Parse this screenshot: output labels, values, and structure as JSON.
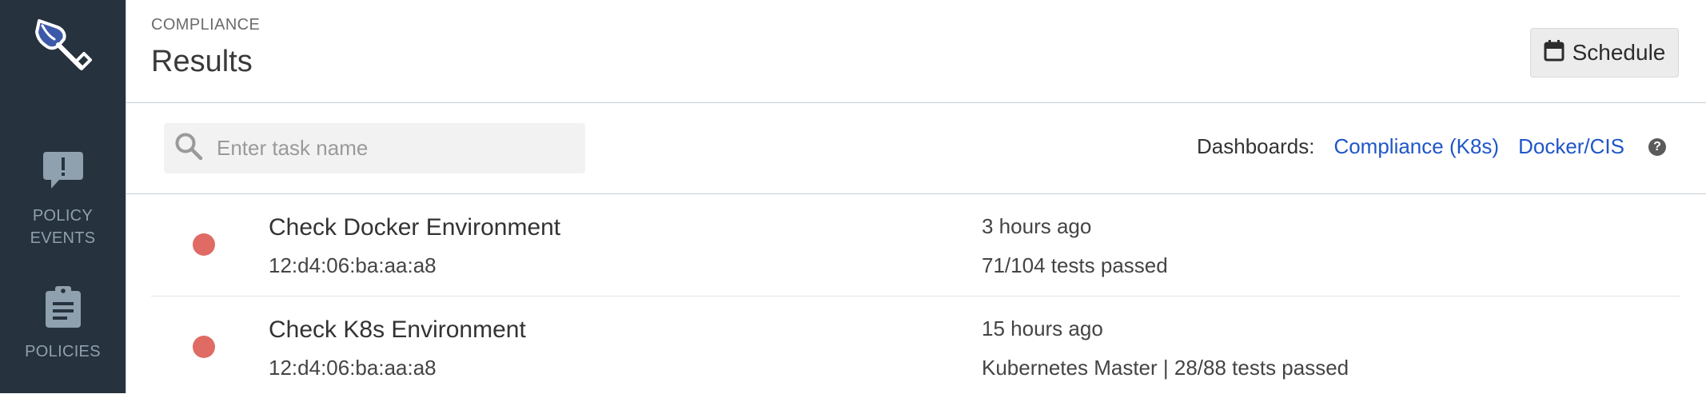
{
  "sidebar": {
    "items": [
      {
        "label_line1": "POLICY",
        "label_line2": "EVENTS",
        "icon": "alert-message-icon"
      },
      {
        "label_line1": "POLICIES",
        "label_line2": "",
        "icon": "clipboard-icon"
      }
    ]
  },
  "header": {
    "eyebrow": "COMPLIANCE",
    "title": "Results",
    "schedule_label": "Schedule"
  },
  "toolbar": {
    "search": {
      "placeholder": "Enter task name",
      "value": ""
    },
    "dashboards_label": "Dashboards:",
    "dashboard_links": [
      "Compliance (K8s)",
      "Docker/CIS"
    ]
  },
  "results": [
    {
      "name": "Check Docker Environment",
      "id": "12:d4:06:ba:aa:a8",
      "time": "3 hours ago",
      "summary": "71/104 tests passed",
      "status": "failed"
    },
    {
      "name": "Check K8s Environment",
      "id": "12:d4:06:ba:aa:a8",
      "time": "15 hours ago",
      "summary": "Kubernetes Master | 28/88 tests passed",
      "status": "failed"
    }
  ],
  "colors": {
    "sidebar_bg": "#26323d",
    "link": "#1f56c8",
    "status_failed": "#e06a64"
  }
}
